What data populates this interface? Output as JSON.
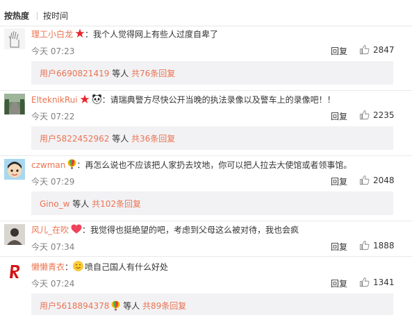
{
  "sort": {
    "hot_label": "按热度",
    "time_label": "按时间"
  },
  "ui": {
    "reply_label": "回复",
    "separator": "：",
    "etc_label": "等人"
  },
  "colors": {
    "link": "#eb7350",
    "subbox": "#f2f2f5",
    "text": "#333333",
    "muted": "#808080"
  },
  "comments": [
    {
      "user": "理工小白龙",
      "text": "我个人觉得网上有些人过度自卑了",
      "time": "今天 07:23",
      "likes": "2847",
      "sub_user": "用户6690821419",
      "sub_total": "共76条回复",
      "badges": [
        "red-star-badge"
      ]
    },
    {
      "user": "ElteknikRui",
      "text": "请瑞典警方尽快公开当晚的执法录像以及警车上的录像吧！！",
      "time": "今天 07:22",
      "likes": "2235",
      "sub_user": "用户5822452962",
      "sub_total": "共36条回复",
      "badges": [
        "red-star-badge",
        "panda-badge"
      ]
    },
    {
      "user": "czwman",
      "text": "再怎么说也不应该把人家扔去坟地，你可以把人拉去大使馆或者领事馆。",
      "time": "今天 07:29",
      "likes": "2048",
      "sub_user": "Gino_w",
      "sub_total": "共102条回复",
      "badges": [
        "balloon-badge"
      ]
    },
    {
      "user": "风儿_在吹",
      "text": "我觉得也挺绝望的吧，考虑到父母这么被对待，我也会疯",
      "time": "今天 07:34",
      "likes": "1888",
      "badges": [
        "heart-badge"
      ]
    },
    {
      "user": "懒懒青衣",
      "text": "喷自己国人有什么好处",
      "time": "今天 07:24",
      "likes": "1341",
      "sub_user": "用户5618894378",
      "sub_total": "共89条回复",
      "badges": [
        "smile-emoji",
        "balloon-badge"
      ]
    }
  ]
}
